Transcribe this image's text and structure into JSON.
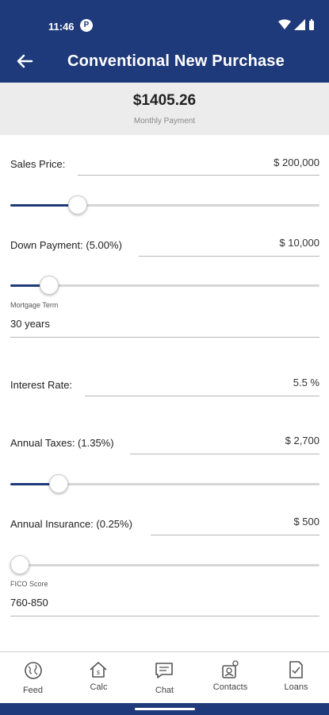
{
  "status_bar": {
    "time": "11:46",
    "notification_glyph": "P"
  },
  "header": {
    "title": "Conventional New Purchase",
    "back_icon": "back-arrow-icon"
  },
  "summary": {
    "monthly_payment": "$1405.26",
    "monthly_payment_label": "Monthly Payment"
  },
  "form": {
    "sales_price": {
      "label": "Sales Price:",
      "value": "$ 200,000",
      "slider_level": 0.2
    },
    "down_payment": {
      "label": "Down Payment: (5.00%)",
      "value": "$ 10,000",
      "slider_level": 0.1
    },
    "mortgage_term": {
      "label": "Mortgage Term",
      "value": "30 years"
    },
    "interest_rate": {
      "label": "Interest Rate:",
      "value": "5.5 %"
    },
    "annual_taxes": {
      "label": "Annual Taxes: (1.35%)",
      "value": "$ 2,700",
      "slider_level": 0.135
    },
    "annual_insurance": {
      "label": "Annual Insurance: (0.25%)",
      "value": "$ 500",
      "slider_level": 0.0
    },
    "fico_score": {
      "label": "FICO Score",
      "value": "760-850"
    }
  },
  "bottom_nav": {
    "items": [
      {
        "label": "Feed",
        "icon": "globe-icon"
      },
      {
        "label": "Calc",
        "icon": "home-calc-icon"
      },
      {
        "label": "Chat",
        "icon": "chat-icon"
      },
      {
        "label": "Contacts",
        "icon": "contacts-icon"
      },
      {
        "label": "Loans",
        "icon": "document-icon"
      }
    ]
  },
  "colors": {
    "brand": "#1f3a7a",
    "panel": "#ececec",
    "track": "#d6d6d6"
  }
}
